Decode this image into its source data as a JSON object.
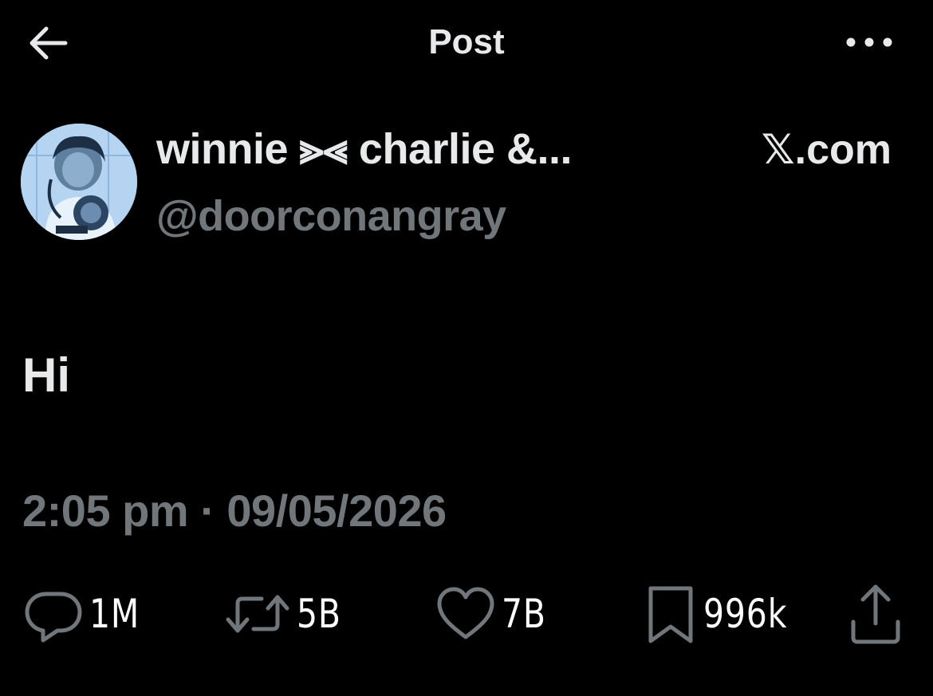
{
  "header": {
    "title": "Post",
    "back_icon": "arrow-left-icon",
    "more_icon": "more-horizontal-icon"
  },
  "author": {
    "display_name": "winnie ⪢⪡ charlie &...",
    "handle": "@doorconangray",
    "avatar_icon": "avatar-photo"
  },
  "source": "𝕏.com",
  "post": {
    "text": "Hi",
    "timestamp": "2:05 pm · 09/05/2026"
  },
  "actions": {
    "reply": {
      "icon": "reply-icon",
      "count": "1M"
    },
    "repost": {
      "icon": "repost-icon",
      "count": "5B"
    },
    "like": {
      "icon": "heart-icon",
      "count": "7B"
    },
    "bookmark": {
      "icon": "bookmark-icon",
      "count": "996k"
    },
    "share": {
      "icon": "share-icon"
    }
  },
  "colors": {
    "background": "#000000",
    "primary_text": "#e7e9ea",
    "secondary_text": "#71767b",
    "count_text": "#ffffff"
  }
}
